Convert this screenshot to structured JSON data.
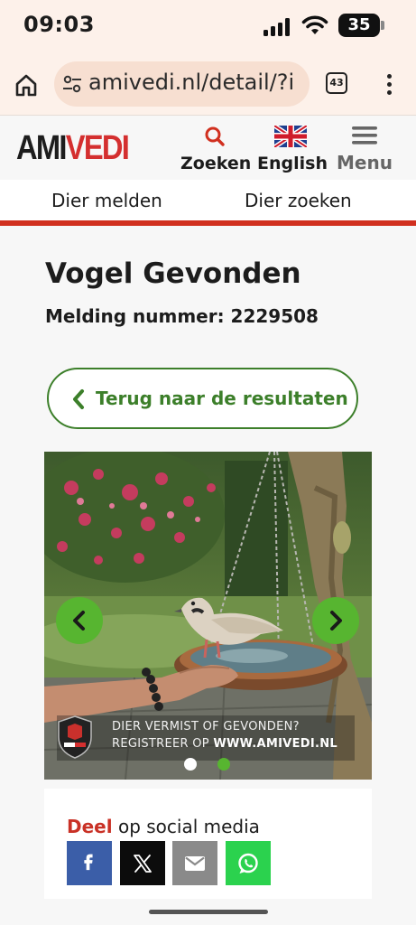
{
  "status_bar": {
    "time": "09:03",
    "battery": "35",
    "battery_level": 0.35,
    "icons": [
      "signal-icon",
      "wifi-icon",
      "battery-icon"
    ]
  },
  "browser": {
    "url": "amivedi.nl/detail/?i",
    "tab_count": "43",
    "icons": [
      "home-icon",
      "site-settings-icon",
      "tabs-icon",
      "more-vert-icon"
    ]
  },
  "site_header": {
    "logo_ami": "AMI",
    "logo_vedi": "VEDI",
    "search_label": "Zoeken",
    "language_label": "English",
    "menu_label": "Menu",
    "icons": [
      "search-icon",
      "uk-flag-icon",
      "hamburger-icon"
    ]
  },
  "subnav": {
    "report_link": "Dier melden",
    "search_link": "Dier zoeken"
  },
  "main": {
    "title": "Vogel Gevonden",
    "report_number": "Melding nummer: 2229508",
    "back_button": "Terug naar de resultaten"
  },
  "photo": {
    "watermark_line1": "DIER VERMIST OF GEVONDEN?",
    "watermark_line2_prefix": "REGISTREER OP ",
    "watermark_line2_site": "WWW.AMIVEDI.NL",
    "badge_text": "AMIVEDI",
    "slide_count": 2,
    "active_slide": 2,
    "icons": [
      "chevron-left-icon",
      "chevron-right-icon"
    ]
  },
  "share": {
    "title_bold": "Deel",
    "title_rest": " op social media",
    "buttons": [
      "facebook",
      "x",
      "email",
      "whatsapp"
    ]
  },
  "colors": {
    "brand_red": "#d42f2f",
    "accent_green": "#57b530",
    "button_green": "#3c7f2a",
    "browser_chrome": "#fdf1ea"
  }
}
